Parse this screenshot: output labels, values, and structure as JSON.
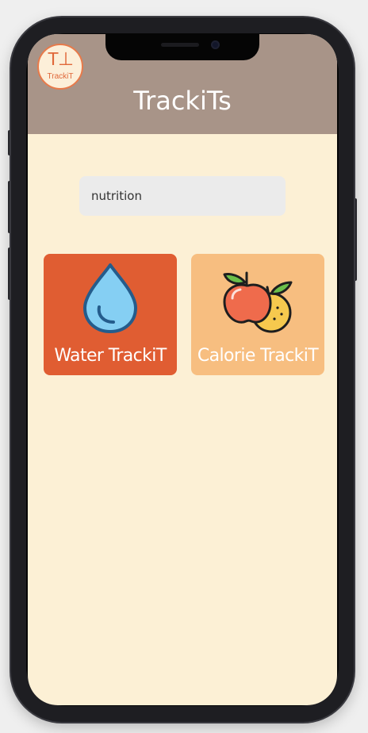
{
  "header": {
    "logo": {
      "mark": "T⊥",
      "text": "TrackiT"
    },
    "title": "TrackiTs"
  },
  "search": {
    "value": "nutrition",
    "placeholder": ""
  },
  "tiles": [
    {
      "label": "Water TrackiT",
      "icon": "water-drop-icon",
      "color": "#e05d32"
    },
    {
      "label": "Calorie TrackiT",
      "icon": "fruit-icon",
      "color": "#f7be80"
    }
  ],
  "colors": {
    "header": "#a89488",
    "background": "#fcf0d5",
    "accent": "#e87a4a"
  }
}
